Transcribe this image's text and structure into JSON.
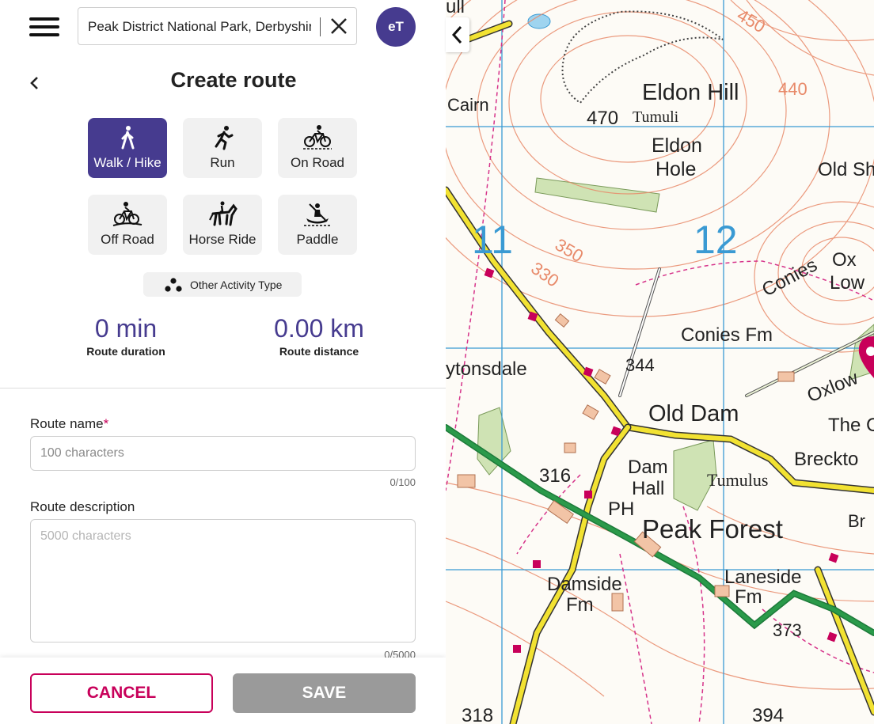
{
  "search": {
    "value": "Peak District National Park, Derbyshire,"
  },
  "user": {
    "initials": "eT"
  },
  "header": {
    "title": "Create route"
  },
  "activities": [
    {
      "label": "Walk / Hike",
      "icon": "walk-icon",
      "selected": true
    },
    {
      "label": "Run",
      "icon": "run-icon",
      "selected": false
    },
    {
      "label": "On Road",
      "icon": "road-bike-icon",
      "selected": false
    },
    {
      "label": "Off Road",
      "icon": "mountain-bike-icon",
      "selected": false
    },
    {
      "label": "Horse Ride",
      "icon": "horse-icon",
      "selected": false
    },
    {
      "label": "Paddle",
      "icon": "paddle-icon",
      "selected": false
    }
  ],
  "other_activity": {
    "label": "Other Activity Type",
    "icon": "dots-icon"
  },
  "stats": {
    "duration_value": "0 min",
    "duration_label": "Route duration",
    "distance_value": "0.00 km",
    "distance_label": "Route distance"
  },
  "form": {
    "name_label": "Route name",
    "name_required_mark": "*",
    "name_placeholder": "100 characters",
    "name_count": "0/100",
    "desc_label": "Route description",
    "desc_placeholder": "5000 characters",
    "desc_count": "0/5000"
  },
  "footer": {
    "cancel_label": "CANCEL",
    "save_label": "SAVE"
  },
  "colors": {
    "accent": "#463b8f",
    "cancel": "#c8005a",
    "save_disabled": "#9a9a9a"
  },
  "map": {
    "labels": {
      "eldon_hill": "Eldon Hill",
      "eldon_hole_1": "Eldon",
      "eldon_hole_2": "Hole",
      "tumuli": "Tumuli",
      "h470": "470",
      "old_sh": "Old Sh",
      "grid11": "11",
      "grid12": "12",
      "c350": "350",
      "c330": "330",
      "c450": "450",
      "c440": "440",
      "conies": "Conies",
      "ox": "Ox",
      "low": "Low",
      "conies_fm": "Conies Fm",
      "ytonsdale": "ytonsdale",
      "h344": "344",
      "old_dam": "Old Dam",
      "oxlow": "Oxlow",
      "the_c": "The C",
      "breckto": "Breckto",
      "h316": "316",
      "dam": "Dam",
      "hall": "Hall",
      "tumulus": "Tumulus",
      "ph": "PH",
      "peak_forest": "Peak Forest",
      "br": "Br",
      "laneside": "Laneside",
      "fm1": "Fm",
      "damside": "Damside",
      "fm2": "Fm",
      "h373": "373",
      "h318": "318",
      "h394": "394",
      "cairn": "Cairn",
      "ull": "ull"
    }
  }
}
